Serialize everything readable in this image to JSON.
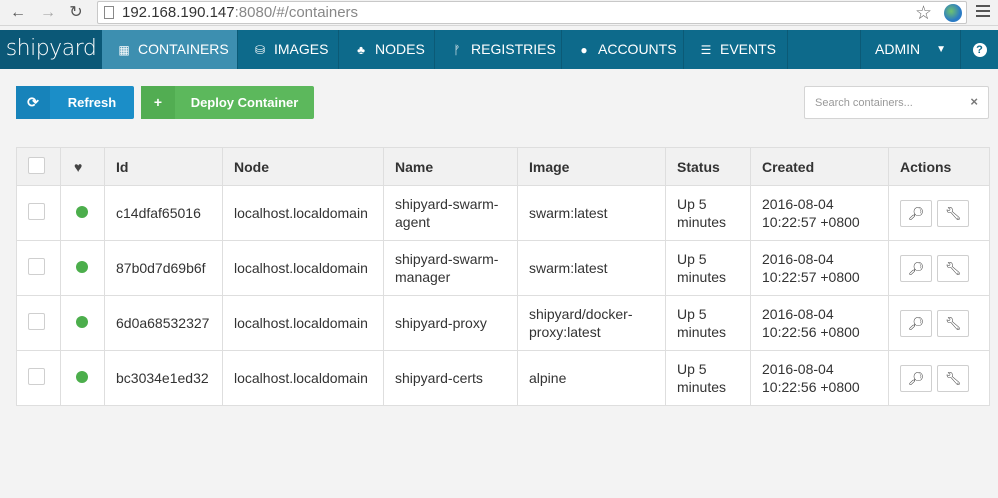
{
  "browser": {
    "url_host": "192.168.190.147",
    "url_rest": ":8080/#/containers",
    "icons": {
      "back": "arrow-left-icon",
      "forward": "arrow-right-icon",
      "reload": "reload-icon",
      "star": "star-icon",
      "menu": "hamburger-menu-icon"
    }
  },
  "navbar": {
    "brand": "shipyard",
    "items": [
      {
        "label": "CONTAINERS",
        "icon": "grid-icon",
        "active": true
      },
      {
        "label": "IMAGES",
        "icon": "drive-icon",
        "active": false
      },
      {
        "label": "NODES",
        "icon": "sitemap-icon",
        "active": false
      },
      {
        "label": "REGISTRIES",
        "icon": "fork-icon",
        "active": false
      },
      {
        "label": "ACCOUNTS",
        "icon": "user-icon",
        "active": false
      },
      {
        "label": "EVENTS",
        "icon": "list-icon",
        "active": false
      }
    ],
    "user": "ADMIN",
    "help": "?"
  },
  "toolbar": {
    "refresh_label": "Refresh",
    "deploy_label": "Deploy Container",
    "search_placeholder": "Search containers...",
    "clear_glyph": "×"
  },
  "table": {
    "headers": [
      "Id",
      "Node",
      "Name",
      "Image",
      "Status",
      "Created",
      "Actions"
    ],
    "rows": [
      {
        "id": "c14dfaf65016",
        "node": "localhost.localdomain",
        "name": [
          "shipyard-swarm-",
          "agent"
        ],
        "image": [
          "swarm:latest"
        ],
        "status": [
          "Up 5",
          "minutes"
        ],
        "created": [
          "2016-08-04",
          "10:22:57 +0800"
        ]
      },
      {
        "id": "87b0d7d69b6f",
        "node": "localhost.localdomain",
        "name": [
          "shipyard-swarm-",
          "manager"
        ],
        "image": [
          "swarm:latest"
        ],
        "status": [
          "Up 5",
          "minutes"
        ],
        "created": [
          "2016-08-04",
          "10:22:57 +0800"
        ]
      },
      {
        "id": "6d0a68532327",
        "node": "localhost.localdomain",
        "name": [
          "shipyard-proxy"
        ],
        "image": [
          "shipyard/docker-",
          "proxy:latest"
        ],
        "status": [
          "Up 5",
          "minutes"
        ],
        "created": [
          "2016-08-04",
          "10:22:56 +0800"
        ]
      },
      {
        "id": "bc3034e1ed32",
        "node": "localhost.localdomain",
        "name": [
          "shipyard-certs"
        ],
        "image": [
          "alpine"
        ],
        "status": [
          "Up 5",
          "minutes"
        ],
        "created": [
          "2016-08-04",
          "10:22:56 +0800"
        ]
      }
    ],
    "status_color": "#4cae4c"
  }
}
